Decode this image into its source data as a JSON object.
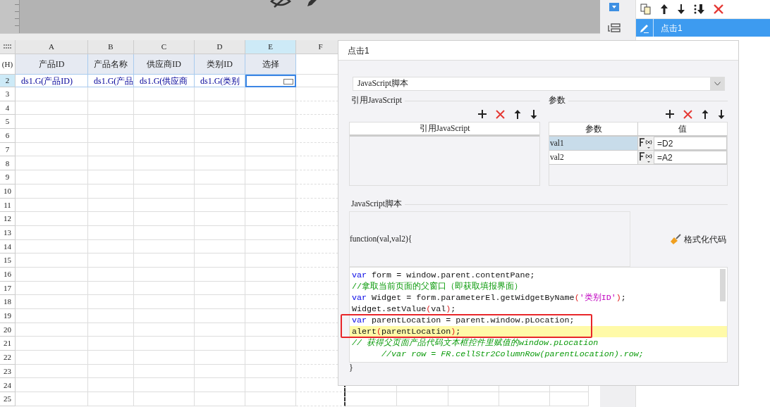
{
  "sheet": {
    "columns": [
      {
        "name": "A",
        "selected": false
      },
      {
        "name": "B",
        "selected": false
      },
      {
        "name": "C",
        "selected": false
      },
      {
        "name": "D",
        "selected": false
      },
      {
        "name": "E",
        "selected": true
      },
      {
        "name": "F",
        "selected": false
      }
    ],
    "rows": [
      {
        "label": "(H)",
        "selected": false,
        "cells": [
          "产品ID",
          "产品名称",
          "供应商ID",
          "类别ID",
          "选择"
        ]
      },
      {
        "label": "2",
        "selected": true,
        "cells": [
          "ds1.G(产品ID)",
          "ds1.G(产品",
          "ds1.G(供应商",
          "ds1.G(类别",
          ""
        ]
      }
    ],
    "row_labels": [
      "3",
      "4",
      "5",
      "6",
      "7",
      "8",
      "9",
      "10",
      "11",
      "12",
      "13",
      "14",
      "15",
      "16",
      "17",
      "18",
      "19",
      "20",
      "21",
      "22",
      "23",
      "24",
      "25"
    ]
  },
  "events": {
    "items": [
      {
        "label": "点击1",
        "selected": true
      }
    ]
  },
  "dialog": {
    "title": "点击1",
    "type_select": "JavaScript脚本",
    "referenced_js": {
      "title": "引用JavaScript",
      "column": "引用JavaScript"
    },
    "parameters": {
      "title": "参数",
      "columns": [
        "参数",
        "值"
      ],
      "rows": [
        {
          "name": "val1",
          "value": "=D2",
          "selected": true
        },
        {
          "name": "val2",
          "value": "=A2",
          "selected": false
        }
      ]
    },
    "script": {
      "title": "JavaScript脚本",
      "signature": "function(val,val2){",
      "format_button": "格式化代码",
      "closing": "}",
      "lines": [
        {
          "highlighted": false,
          "tokens": [
            {
              "kind": "keyword",
              "text": "var"
            },
            {
              "kind": "plain",
              "text": " form = window.parent.contentPane;"
            }
          ]
        },
        {
          "highlighted": false,
          "tokens": [
            {
              "kind": "comment",
              "text": "//拿取当前页面的父窗口（即获取填报界面）"
            }
          ]
        },
        {
          "highlighted": false,
          "tokens": [
            {
              "kind": "keyword",
              "text": "var"
            },
            {
              "kind": "plain",
              "text": " Widget = form.parameterEl.getWidgetByName"
            },
            {
              "kind": "paren",
              "text": "("
            },
            {
              "kind": "string",
              "text": "'类别ID'"
            },
            {
              "kind": "paren",
              "text": ")"
            },
            {
              "kind": "plain",
              "text": ";"
            }
          ]
        },
        {
          "highlighted": false,
          "tokens": [
            {
              "kind": "plain",
              "text": "Widget.setValue"
            },
            {
              "kind": "paren",
              "text": "("
            },
            {
              "kind": "plain",
              "text": "val"
            },
            {
              "kind": "paren",
              "text": ")"
            },
            {
              "kind": "plain",
              "text": ";"
            }
          ]
        },
        {
          "highlighted": false,
          "tokens": [
            {
              "kind": "keyword",
              "text": "var"
            },
            {
              "kind": "plain",
              "text": " parentLocation = parent.window.pLocation;"
            }
          ]
        },
        {
          "highlighted": true,
          "tokens": [
            {
              "kind": "plain",
              "text": "alert"
            },
            {
              "kind": "paren",
              "text": "("
            },
            {
              "kind": "plain",
              "text": "parentLocation"
            },
            {
              "kind": "paren",
              "text": ")"
            },
            {
              "kind": "plain",
              "text": ";"
            }
          ]
        },
        {
          "highlighted": false,
          "tokens": [
            {
              "kind": "comment",
              "text": "// 获得父页面产品代码文本框控件里赋值的window.pLocation"
            }
          ]
        },
        {
          "highlighted": false,
          "tokens": [
            {
              "kind": "comment",
              "text": "      //var row = FR.cellStr2ColumnRow(parentLocation).row;"
            }
          ]
        }
      ]
    }
  }
}
